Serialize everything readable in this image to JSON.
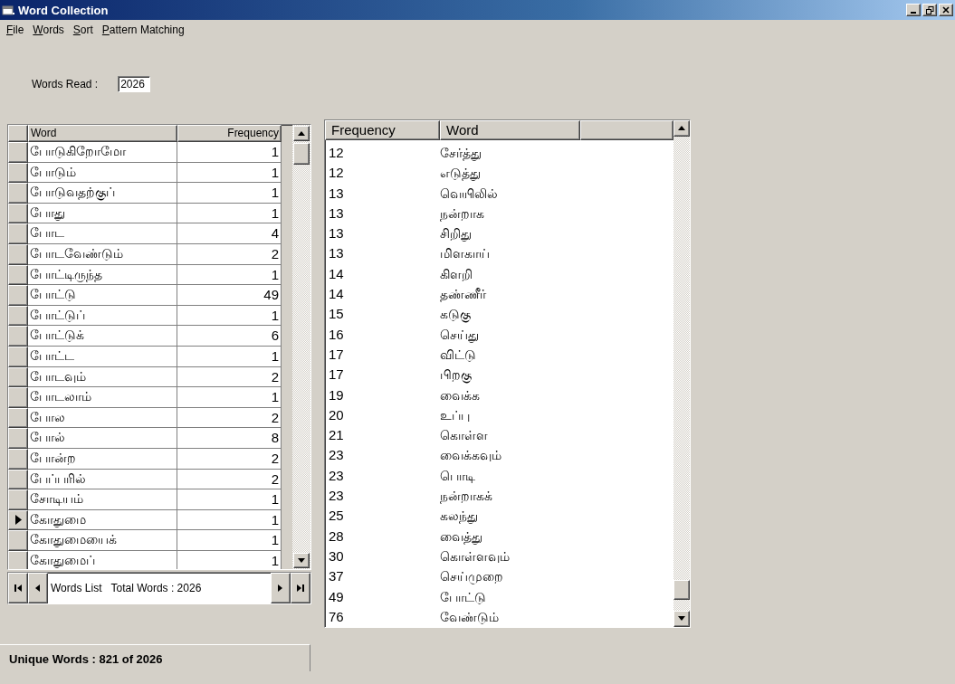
{
  "window": {
    "title": "Word Collection"
  },
  "menu": [
    {
      "label": "File"
    },
    {
      "label": "Words"
    },
    {
      "label": "Sort"
    },
    {
      "label": "Pattern Matching"
    }
  ],
  "words_read": {
    "label": "Words Read :",
    "value": "2026"
  },
  "left_grid": {
    "columns": [
      "Word",
      "Frequency"
    ],
    "rows": [
      {
        "word": "போடுகிறோமோ",
        "frequency": "1",
        "selected": false
      },
      {
        "word": "போடும்",
        "frequency": "1",
        "selected": false
      },
      {
        "word": "போடுவதற்குப்",
        "frequency": "1",
        "selected": false
      },
      {
        "word": "போது",
        "frequency": "1",
        "selected": false
      },
      {
        "word": "போட",
        "frequency": "4",
        "selected": false
      },
      {
        "word": "போடவேண்டும்",
        "frequency": "2",
        "selected": false
      },
      {
        "word": "போட்டிருந்த",
        "frequency": "1",
        "selected": false
      },
      {
        "word": "போட்டு",
        "frequency": "49",
        "selected": false
      },
      {
        "word": "போட்டுப்",
        "frequency": "1",
        "selected": false
      },
      {
        "word": "போட்டுக்",
        "frequency": "6",
        "selected": false
      },
      {
        "word": "போட்ட",
        "frequency": "1",
        "selected": false
      },
      {
        "word": "போடவும்",
        "frequency": "2",
        "selected": false
      },
      {
        "word": "போடலாம்",
        "frequency": "1",
        "selected": false
      },
      {
        "word": "போல",
        "frequency": "2",
        "selected": false
      },
      {
        "word": "போல்",
        "frequency": "8",
        "selected": false
      },
      {
        "word": "போன்ற",
        "frequency": "2",
        "selected": false
      },
      {
        "word": "பேப்பரில்",
        "frequency": "2",
        "selected": false
      },
      {
        "word": "சோடியம்",
        "frequency": "1",
        "selected": false
      },
      {
        "word": "கோதுமை",
        "frequency": "1",
        "selected": true
      },
      {
        "word": "கோதுமையைக்",
        "frequency": "1",
        "selected": false
      },
      {
        "word": "கோதுமைப்",
        "frequency": "1",
        "selected": false
      }
    ],
    "navigator": {
      "caption": "Words List",
      "total": "Total Words : 2026"
    }
  },
  "right_list": {
    "columns": [
      "Frequency",
      "Word"
    ],
    "rows": [
      {
        "frequency": "12",
        "word": "சேர்த்து"
      },
      {
        "frequency": "12",
        "word": "எடுத்து"
      },
      {
        "frequency": "13",
        "word": "வெயிலில்"
      },
      {
        "frequency": "13",
        "word": "நன்றாக"
      },
      {
        "frequency": "13",
        "word": "சிறிது"
      },
      {
        "frequency": "13",
        "word": "மிளகாய்"
      },
      {
        "frequency": "14",
        "word": "கிளறி"
      },
      {
        "frequency": "14",
        "word": "தண்ணீர்"
      },
      {
        "frequency": "15",
        "word": "கடுகு"
      },
      {
        "frequency": "16",
        "word": "செய்து"
      },
      {
        "frequency": "17",
        "word": "விட்டு"
      },
      {
        "frequency": "17",
        "word": "பிறகு"
      },
      {
        "frequency": "19",
        "word": "வைக்க"
      },
      {
        "frequency": "20",
        "word": "உப்பு"
      },
      {
        "frequency": "21",
        "word": "கொள்ள"
      },
      {
        "frequency": "23",
        "word": "வைக்கவும்"
      },
      {
        "frequency": "23",
        "word": "பொடி"
      },
      {
        "frequency": "23",
        "word": "நன்றாகக்"
      },
      {
        "frequency": "25",
        "word": "கலந்து"
      },
      {
        "frequency": "28",
        "word": "வைத்து"
      },
      {
        "frequency": "30",
        "word": "கொள்ளவும்"
      },
      {
        "frequency": "37",
        "word": "செய்முறை"
      },
      {
        "frequency": "49",
        "word": "போட்டு"
      },
      {
        "frequency": "76",
        "word": "வேண்டும்"
      }
    ]
  },
  "status_bar": {
    "text": "Unique Words : 821 of 2026"
  }
}
